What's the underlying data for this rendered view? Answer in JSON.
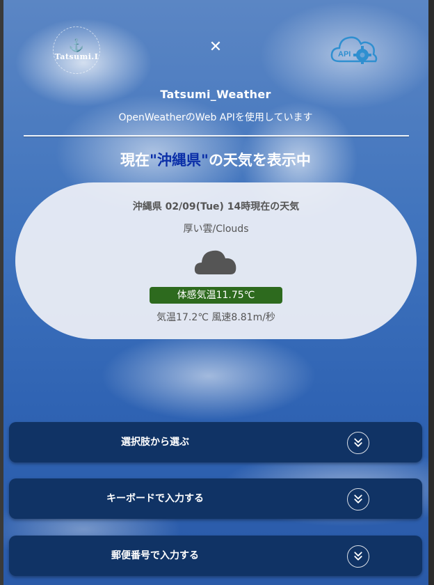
{
  "header": {
    "logo_text": "Tatsumi.I",
    "close_symbol": "✕",
    "api_icon_text": "API"
  },
  "app": {
    "title": "Tatsumi_Weather",
    "subtitle": "OpenWeatherのWeb APIを使用しています"
  },
  "status": {
    "prefix": "現在",
    "prefecture": "\"沖縄県\"",
    "suffix": "の天気を表示中"
  },
  "weather": {
    "header": "沖縄県 02/09(Tue) 14時現在の天気",
    "description": "厚い雲/Clouds",
    "icon": "cloud-icon",
    "feels_like": "体感気温11.75℃",
    "temp_wind": "気温17.2℃ 風速8.81m/秒"
  },
  "accordions": [
    {
      "label": "選択肢から選ぶ"
    },
    {
      "label": "キーボードで入力する"
    },
    {
      "label": "郵便番号で入力する"
    }
  ],
  "colors": {
    "prefecture_highlight": "#0b2fa8",
    "feels_badge": "#2d6a1e",
    "accordion_bg": "#103365"
  }
}
